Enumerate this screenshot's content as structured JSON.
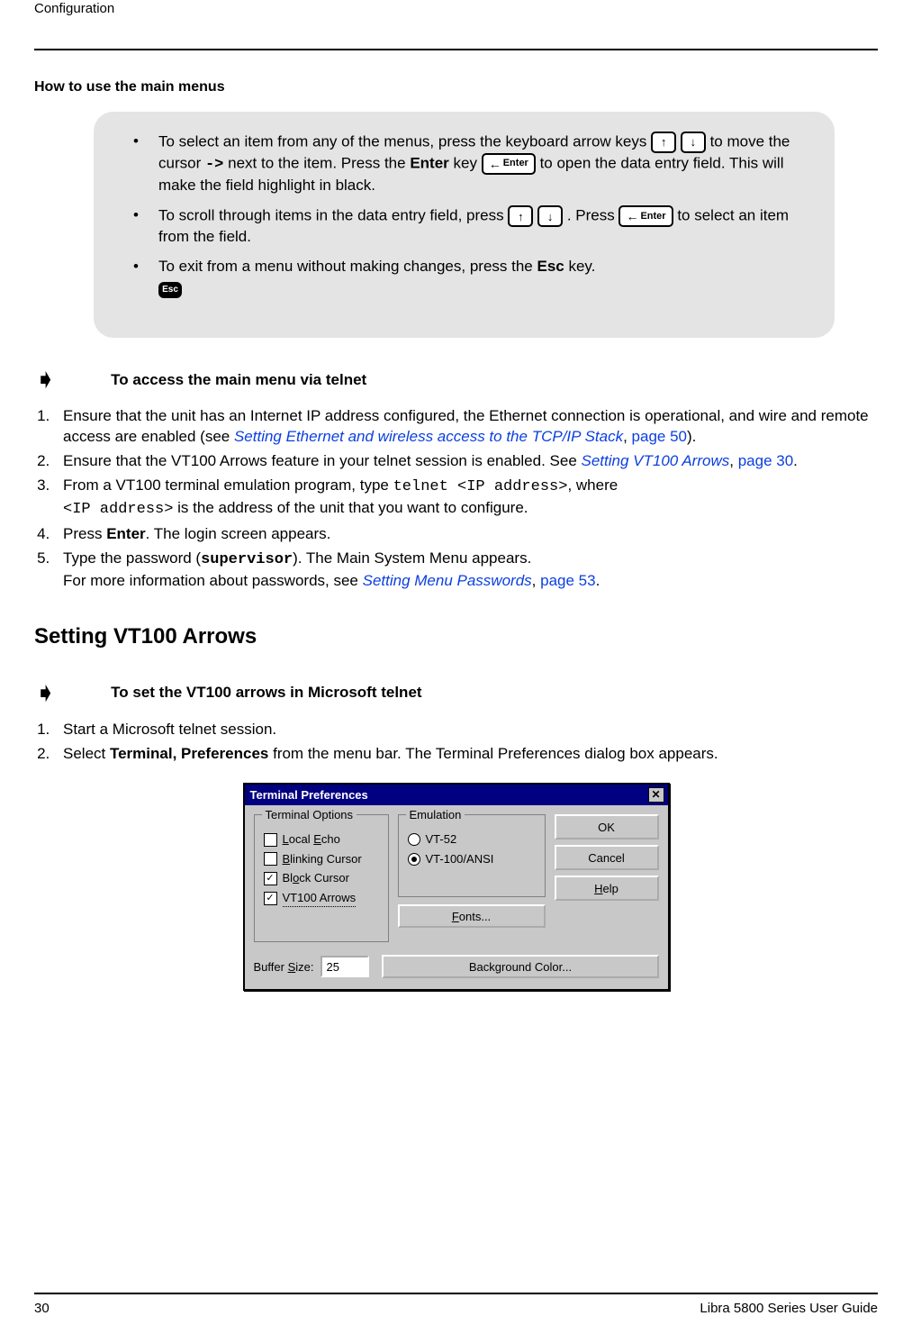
{
  "header": {
    "section": "Configuration"
  },
  "h_small": "How to use the main menus",
  "callout": {
    "item1_a": "To select an item from any of the menus, press the keyboard arrow keys ",
    "cursor": "->",
    "item1_b": " to move the cursor ",
    "item1_c": " next to the item. Press the ",
    "enter_word": "Enter",
    "item1_d": " key ",
    "item1_e": " to open the data entry field. This will make the field highlight in black.",
    "item2_a": "To scroll through items in the data entry field, press ",
    "item2_b": " . Press ",
    "item2_c": " to select an item from the field.",
    "item3_a": "To exit from a menu without making changes, press the ",
    "esc_word": "Esc",
    "item3_b": " key.",
    "enter_key": "Enter",
    "esc_key": "Esc"
  },
  "proc1": {
    "title": "To access the main menu via telnet"
  },
  "steps1": {
    "s1a": "Ensure that the unit has an Internet IP address configured, the Ethernet connection is operational, and wire and remote access are enabled (see ",
    "s1link": "Setting Ethernet and wireless access to the TCP/IP Stack",
    "s1b": ", ",
    "s1page": "page 50",
    "s1c": ").",
    "s2a": "Ensure that the VT100 Arrows feature in your telnet session is enabled. See ",
    "s2link": "Setting VT100 Arrows",
    "s2b": ", ",
    "s2page": "page 30",
    "s2c": ".",
    "s3a": "From a VT100 terminal emulation program, type ",
    "s3cmd": "telnet <IP address>",
    "s3b": ", where ",
    "s3ip": "<IP address>",
    "s3c": " is the address of the unit that you want to configure.",
    "s4a": "Press ",
    "s4enter": "Enter",
    "s4b": ". The login screen appears.",
    "s5a": "Type the password (",
    "s5pwd": "supervisor",
    "s5b": "). The Main System Menu appears.",
    "s5c": "For more information about passwords, see ",
    "s5link": "Setting Menu Passwords",
    "s5d": ", ",
    "s5page": "page 53",
    "s5e": "."
  },
  "h2": "Setting VT100 Arrows",
  "proc2": {
    "title": "To set the VT100 arrows in Microsoft telnet"
  },
  "steps2": {
    "s1": "Start a Microsoft telnet session.",
    "s2a": "Select ",
    "s2b": "Terminal, Preferences",
    "s2c": " from the menu bar. The Terminal Preferences dialog box appears."
  },
  "dialog": {
    "title": "Terminal Preferences",
    "close": "✕",
    "group_options": "Terminal Options",
    "opt_local_echo": "Local Echo",
    "opt_blinking": "Blinking Cursor",
    "opt_block": "Block Cursor",
    "opt_vt100": "VT100 Arrows",
    "group_emulation": "Emulation",
    "emu_vt52": "VT-52",
    "emu_vt100": "VT-100/ANSI",
    "btn_fonts": "Fonts...",
    "buffer_label": "Buffer Size:",
    "buffer_value": "25",
    "btn_bg": "Background Color...",
    "btn_ok": "OK",
    "btn_cancel": "Cancel",
    "btn_help": "Help"
  },
  "footer": {
    "page": "30",
    "guide": "Libra 5800 Series User Guide"
  }
}
